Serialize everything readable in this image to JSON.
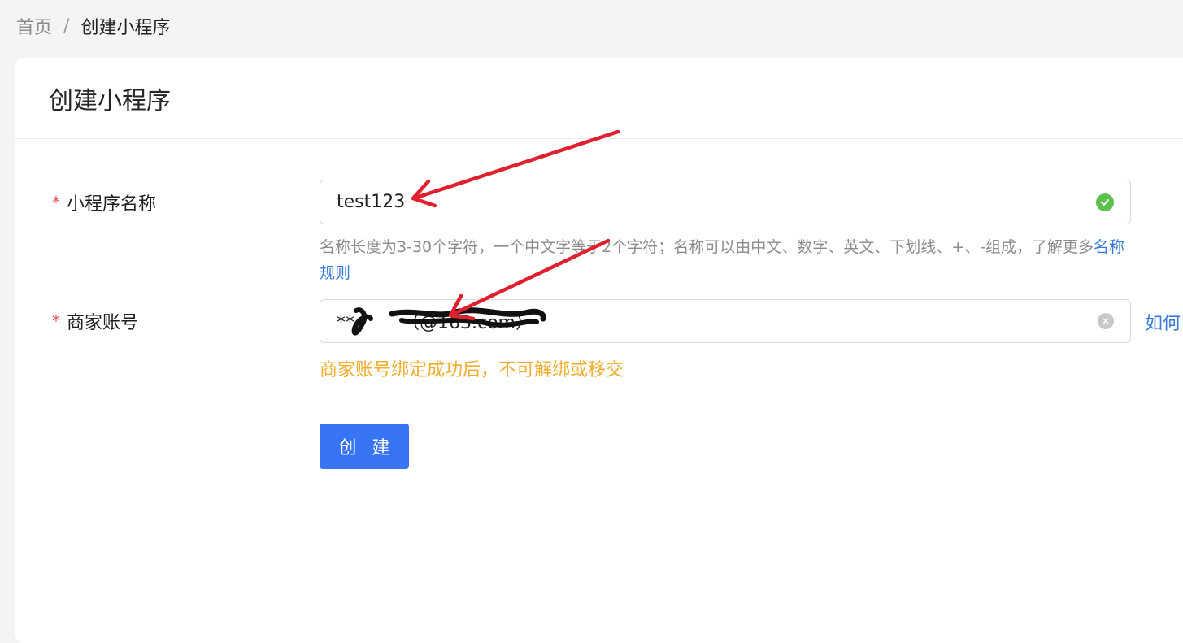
{
  "breadcrumb": {
    "home": "首页",
    "separator": "/",
    "current": "创建小程序"
  },
  "card": {
    "title": "创建小程序"
  },
  "form": {
    "name_field": {
      "required_mark": "*",
      "label": "小程序名称",
      "value": "test123",
      "status_icon": "check-circle-icon",
      "hint_text": "名称长度为3-30个字符，一个中文字等于2个字符；名称可以由中文、数字、英文、下划线、+、-组成，了解更多",
      "hint_link": "名称规则"
    },
    "merchant_field": {
      "required_mark": "*",
      "label": "商家账号",
      "value": "**",
      "value_suffix": "（@163.com）",
      "clear_icon": "close-circle-icon",
      "side_link": "如何",
      "warning": "商家账号绑定成功后，不可解绑或移交"
    },
    "submit_label": "创 建"
  },
  "colors": {
    "primary": "#3875f6",
    "link": "#3a7bdc",
    "required": "#e34d59",
    "success": "#5ec14e",
    "warning": "#f0ad2e",
    "annotation_arrow": "#e0202e"
  }
}
